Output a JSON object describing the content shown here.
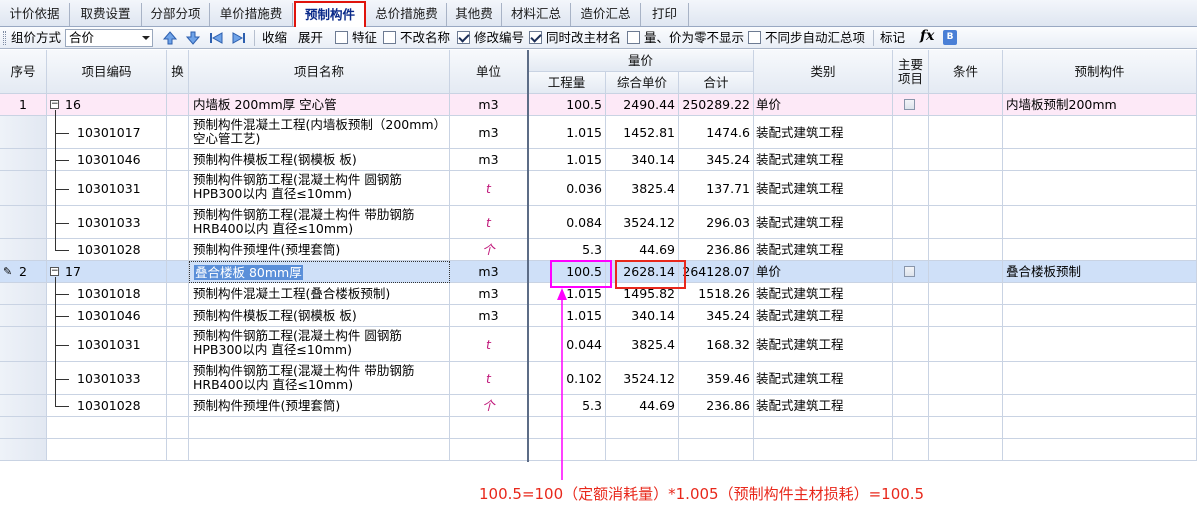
{
  "tabs": [
    {
      "label": "计价依据",
      "active": false
    },
    {
      "label": "取费设置",
      "active": false
    },
    {
      "label": "分部分项",
      "active": false
    },
    {
      "label": "单价措施费",
      "active": false
    },
    {
      "label": "预制构件",
      "active": true
    },
    {
      "label": "总价措施费",
      "active": false
    },
    {
      "label": "其他费",
      "active": false
    },
    {
      "label": "材料汇总",
      "active": false
    },
    {
      "label": "造价汇总",
      "active": false
    },
    {
      "label": "打印",
      "active": false
    }
  ],
  "toolbar": {
    "price_method_label": "组价方式",
    "price_method_value": "合价",
    "collapse": "收缩",
    "expand": "展开",
    "checkboxes": [
      {
        "label": "特征",
        "checked": false
      },
      {
        "label": "不改名称",
        "checked": false
      },
      {
        "label": "修改编号",
        "checked": true
      },
      {
        "label": "同时改主材名",
        "checked": true
      },
      {
        "label": "量、价为零不显示",
        "checked": false
      },
      {
        "label": "不同步自动汇总项",
        "checked": false
      }
    ],
    "mark": "标记",
    "fx": "fx"
  },
  "headers": {
    "seq": "序号",
    "code": "项目编码",
    "swap": "换",
    "name": "项目名称",
    "unit": "单位",
    "group": "量价",
    "qty": "工程量",
    "unit_price": "综合单价",
    "total": "合计",
    "category": "类别",
    "main_item": "主要项目",
    "condition": "条件",
    "prefab": "预制构件"
  },
  "rows": [
    {
      "seq": "1",
      "code": "16",
      "name": "内墙板 200mm厚 空心管",
      "unit": "m3",
      "qty": "100.5",
      "price": "2490.44",
      "total": "250289.22",
      "category": "单价",
      "prefab": "内墙板预制200mm"
    },
    {
      "seq": "",
      "code": "10301017",
      "name": "预制构件混凝土工程(内墙板预制（200mm）空心管工艺)",
      "unit": "m3",
      "qty": "1.015",
      "price": "1452.81",
      "total": "1474.6",
      "category": "装配式建筑工程",
      "prefab": ""
    },
    {
      "seq": "",
      "code": "10301046",
      "name": "预制构件模板工程(钢模板 板)",
      "unit": "m3",
      "qty": "1.015",
      "price": "340.14",
      "total": "345.24",
      "category": "装配式建筑工程",
      "prefab": ""
    },
    {
      "seq": "",
      "code": "10301031",
      "name": "预制构件钢筋工程(混凝土构件 圆钢筋HPB300以内 直径≤10mm)",
      "unit": "t",
      "qty": "0.036",
      "price": "3825.4",
      "total": "137.71",
      "category": "装配式建筑工程",
      "prefab": ""
    },
    {
      "seq": "",
      "code": "10301033",
      "name": "预制构件钢筋工程(混凝土构件 带肋钢筋HRB400以内 直径≤10mm)",
      "unit": "t",
      "qty": "0.084",
      "price": "3524.12",
      "total": "296.03",
      "category": "装配式建筑工程",
      "prefab": ""
    },
    {
      "seq": "",
      "code": "10301028",
      "name": "预制构件预埋件(预埋套筒)",
      "unit": "个",
      "qty": "5.3",
      "price": "44.69",
      "total": "236.86",
      "category": "装配式建筑工程",
      "prefab": ""
    },
    {
      "seq": "2",
      "code": "17",
      "name": "叠合楼板 80mm厚",
      "unit": "m3",
      "qty": "100.5",
      "price": "2628.14",
      "total": "264128.07",
      "category": "单价",
      "prefab": "叠合楼板预制"
    },
    {
      "seq": "",
      "code": "10301018",
      "name": "预制构件混凝土工程(叠合楼板预制)",
      "unit": "m3",
      "qty": "1.015",
      "price": "1495.82",
      "total": "1518.26",
      "category": "装配式建筑工程",
      "prefab": ""
    },
    {
      "seq": "",
      "code": "10301046",
      "name": "预制构件模板工程(钢模板 板)",
      "unit": "m3",
      "qty": "1.015",
      "price": "340.14",
      "total": "345.24",
      "category": "装配式建筑工程",
      "prefab": ""
    },
    {
      "seq": "",
      "code": "10301031",
      "name": "预制构件钢筋工程(混凝土构件 圆钢筋HPB300以内 直径≤10mm)",
      "unit": "t",
      "qty": "0.044",
      "price": "3825.4",
      "total": "168.32",
      "category": "装配式建筑工程",
      "prefab": ""
    },
    {
      "seq": "",
      "code": "10301033",
      "name": "预制构件钢筋工程(混凝土构件 带肋钢筋HRB400以内 直径≤10mm)",
      "unit": "t",
      "qty": "0.102",
      "price": "3524.12",
      "total": "359.46",
      "category": "装配式建筑工程",
      "prefab": ""
    },
    {
      "seq": "",
      "code": "10301028",
      "name": "预制构件预埋件(预埋套筒)",
      "unit": "个",
      "qty": "5.3",
      "price": "44.69",
      "total": "236.86",
      "category": "装配式建筑工程",
      "prefab": ""
    }
  ],
  "annotation": {
    "note": "100.5=100（定额消耗量）*1.005（预制构件主材损耗）=100.5",
    "highlight_color": "#ff00ff",
    "note_color": "#e8281b"
  },
  "colors": {
    "parent_row_bg": "#fde9f7",
    "selected_row_bg": "#cfe0f8",
    "grid_line": "#c9d3e3",
    "active_tab_border": "#e0140c"
  }
}
